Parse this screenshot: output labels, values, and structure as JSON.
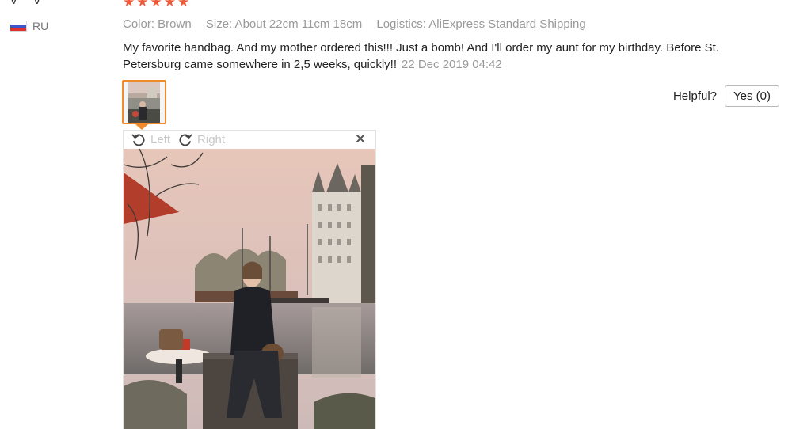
{
  "review": {
    "user_name": "V***V",
    "country_code": "RU",
    "rating": 5,
    "attributes": {
      "color": "Color: Brown",
      "size": "Size: About 22cm 11cm 18cm",
      "logistics": "Logistics: AliExpress Standard Shipping"
    },
    "text": "My favorite handbag. And my mother ordered this!!! Just a bomb! And I'll order my aunt for my birthday. Before St. Petersburg came somewhere in 2,5 weeks, quickly!!",
    "date": "22 Dec 2019 04:42"
  },
  "helpful": {
    "label": "Helpful?",
    "yes_button": "Yes (0)"
  },
  "viewer": {
    "rotate_left_label": "Left",
    "rotate_right_label": "Right"
  },
  "icons": {
    "star": "star-icon",
    "rotate_left": "rotate-left-icon",
    "rotate_right": "rotate-right-icon",
    "close": "close-icon",
    "flag": "russia-flag-icon"
  },
  "colors": {
    "star": "#f0593a",
    "thumb_border": "#f08a2a",
    "muted_text": "#999999",
    "disabled_text": "#c8c8c8"
  }
}
